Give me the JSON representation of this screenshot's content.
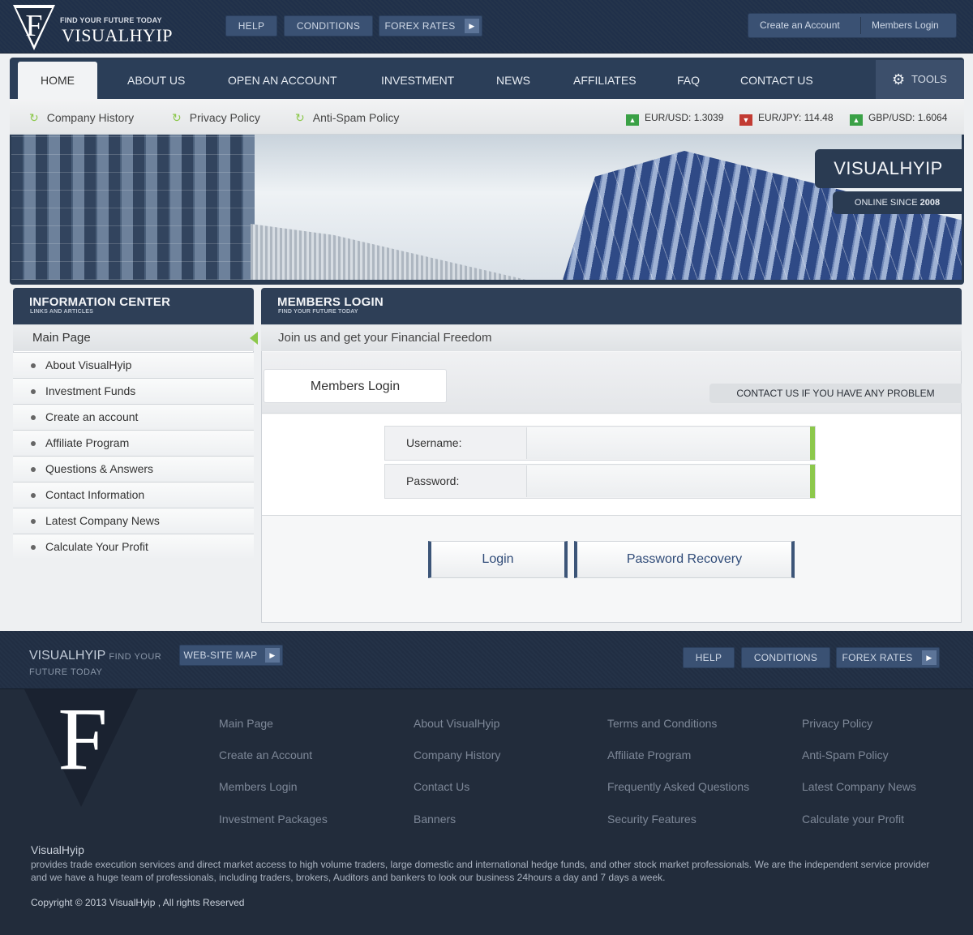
{
  "header": {
    "tagline": "FIND YOUR FUTURE TODAY",
    "brand": "VISUALHYIP",
    "buttons": {
      "help": "HELP",
      "conditions": "CONDITIONS",
      "forex": "FOREX RATES"
    },
    "create_account": "Create an Account",
    "members_login": "Members Login"
  },
  "nav": {
    "items": [
      "HOME",
      "ABOUT US",
      "OPEN AN ACCOUNT",
      "INVESTMENT",
      "NEWS",
      "AFFILIATES",
      "FAQ",
      "CONTACT US"
    ],
    "tools": "TOOLS"
  },
  "subnav": {
    "links": [
      "Company History",
      "Privacy Policy",
      "Anti-Spam Policy"
    ],
    "rates": [
      {
        "pair": "EUR/USD:",
        "value": "1.3039",
        "trend": "up"
      },
      {
        "pair": "EUR/JPY:",
        "value": "114.48",
        "trend": "down"
      },
      {
        "pair": "GBP/USD:",
        "value": "1.6064",
        "trend": "up"
      }
    ]
  },
  "banner": {
    "title": "VISUALHYIP",
    "subtitle_prefix": "ONLINE SINCE",
    "subtitle_year": "2008"
  },
  "sidebar": {
    "title": "INFORMATION CENTER",
    "subtitle": "LINKS AND ARTICLES",
    "main": "Main Page",
    "items": [
      "About VisualHyip",
      "Investment Funds",
      "Create an account",
      "Affiliate Program",
      "Questions & Answers",
      "Contact Information",
      "Latest Company News",
      "Calculate Your Profit"
    ]
  },
  "login": {
    "title": "MEMBERS LOGIN",
    "subtitle": "FIND YOUR FUTURE TODAY",
    "intro": "Join us and get your Financial Freedom",
    "tab": "Members Login",
    "contact_note": "CONTACT US IF YOU HAVE ANY PROBLEM",
    "username_label": "Username:",
    "password_label": "Password:",
    "username_value": "",
    "password_value": "",
    "login_button": "Login",
    "recovery_button": "Password Recovery"
  },
  "footer_bar": {
    "brand": "VISUALHYIP",
    "brand_tag_1": "FIND YOUR",
    "brand_tag_2": "FUTURE TODAY",
    "sitemap": "WEB-SITE MAP",
    "help": "HELP",
    "conditions": "CONDITIONS",
    "forex": "FOREX RATES"
  },
  "footer": {
    "columns": [
      [
        "Main Page",
        "Create an Account",
        "Members Login",
        "Investment Packages"
      ],
      [
        "About VisualHyip",
        "Company History",
        "Contact Us",
        "Banners"
      ],
      [
        "Terms and Conditions",
        "Affiliate Program",
        "Frequently Asked Questions",
        "Security Features"
      ],
      [
        "Privacy Policy",
        "Anti-Spam Policy",
        "Latest Company News",
        "Calculate your Profit"
      ]
    ],
    "about_title": "VisualHyip",
    "about_text": "provides trade execution services and direct market access to high volume traders, large domestic and international hedge funds, and other stock market professionals. We are the independent service provider and we have a huge team of professionals, including traders, brokers, Auditors and bankers to look our business 24hours a day and 7 days a week.",
    "copyright": "Copyright © 2013 VisualHyip , All rights Reserved"
  },
  "colors": {
    "navy": "#2e3f57",
    "accent_green": "#8cc84b",
    "button_blue": "#3a5173"
  }
}
